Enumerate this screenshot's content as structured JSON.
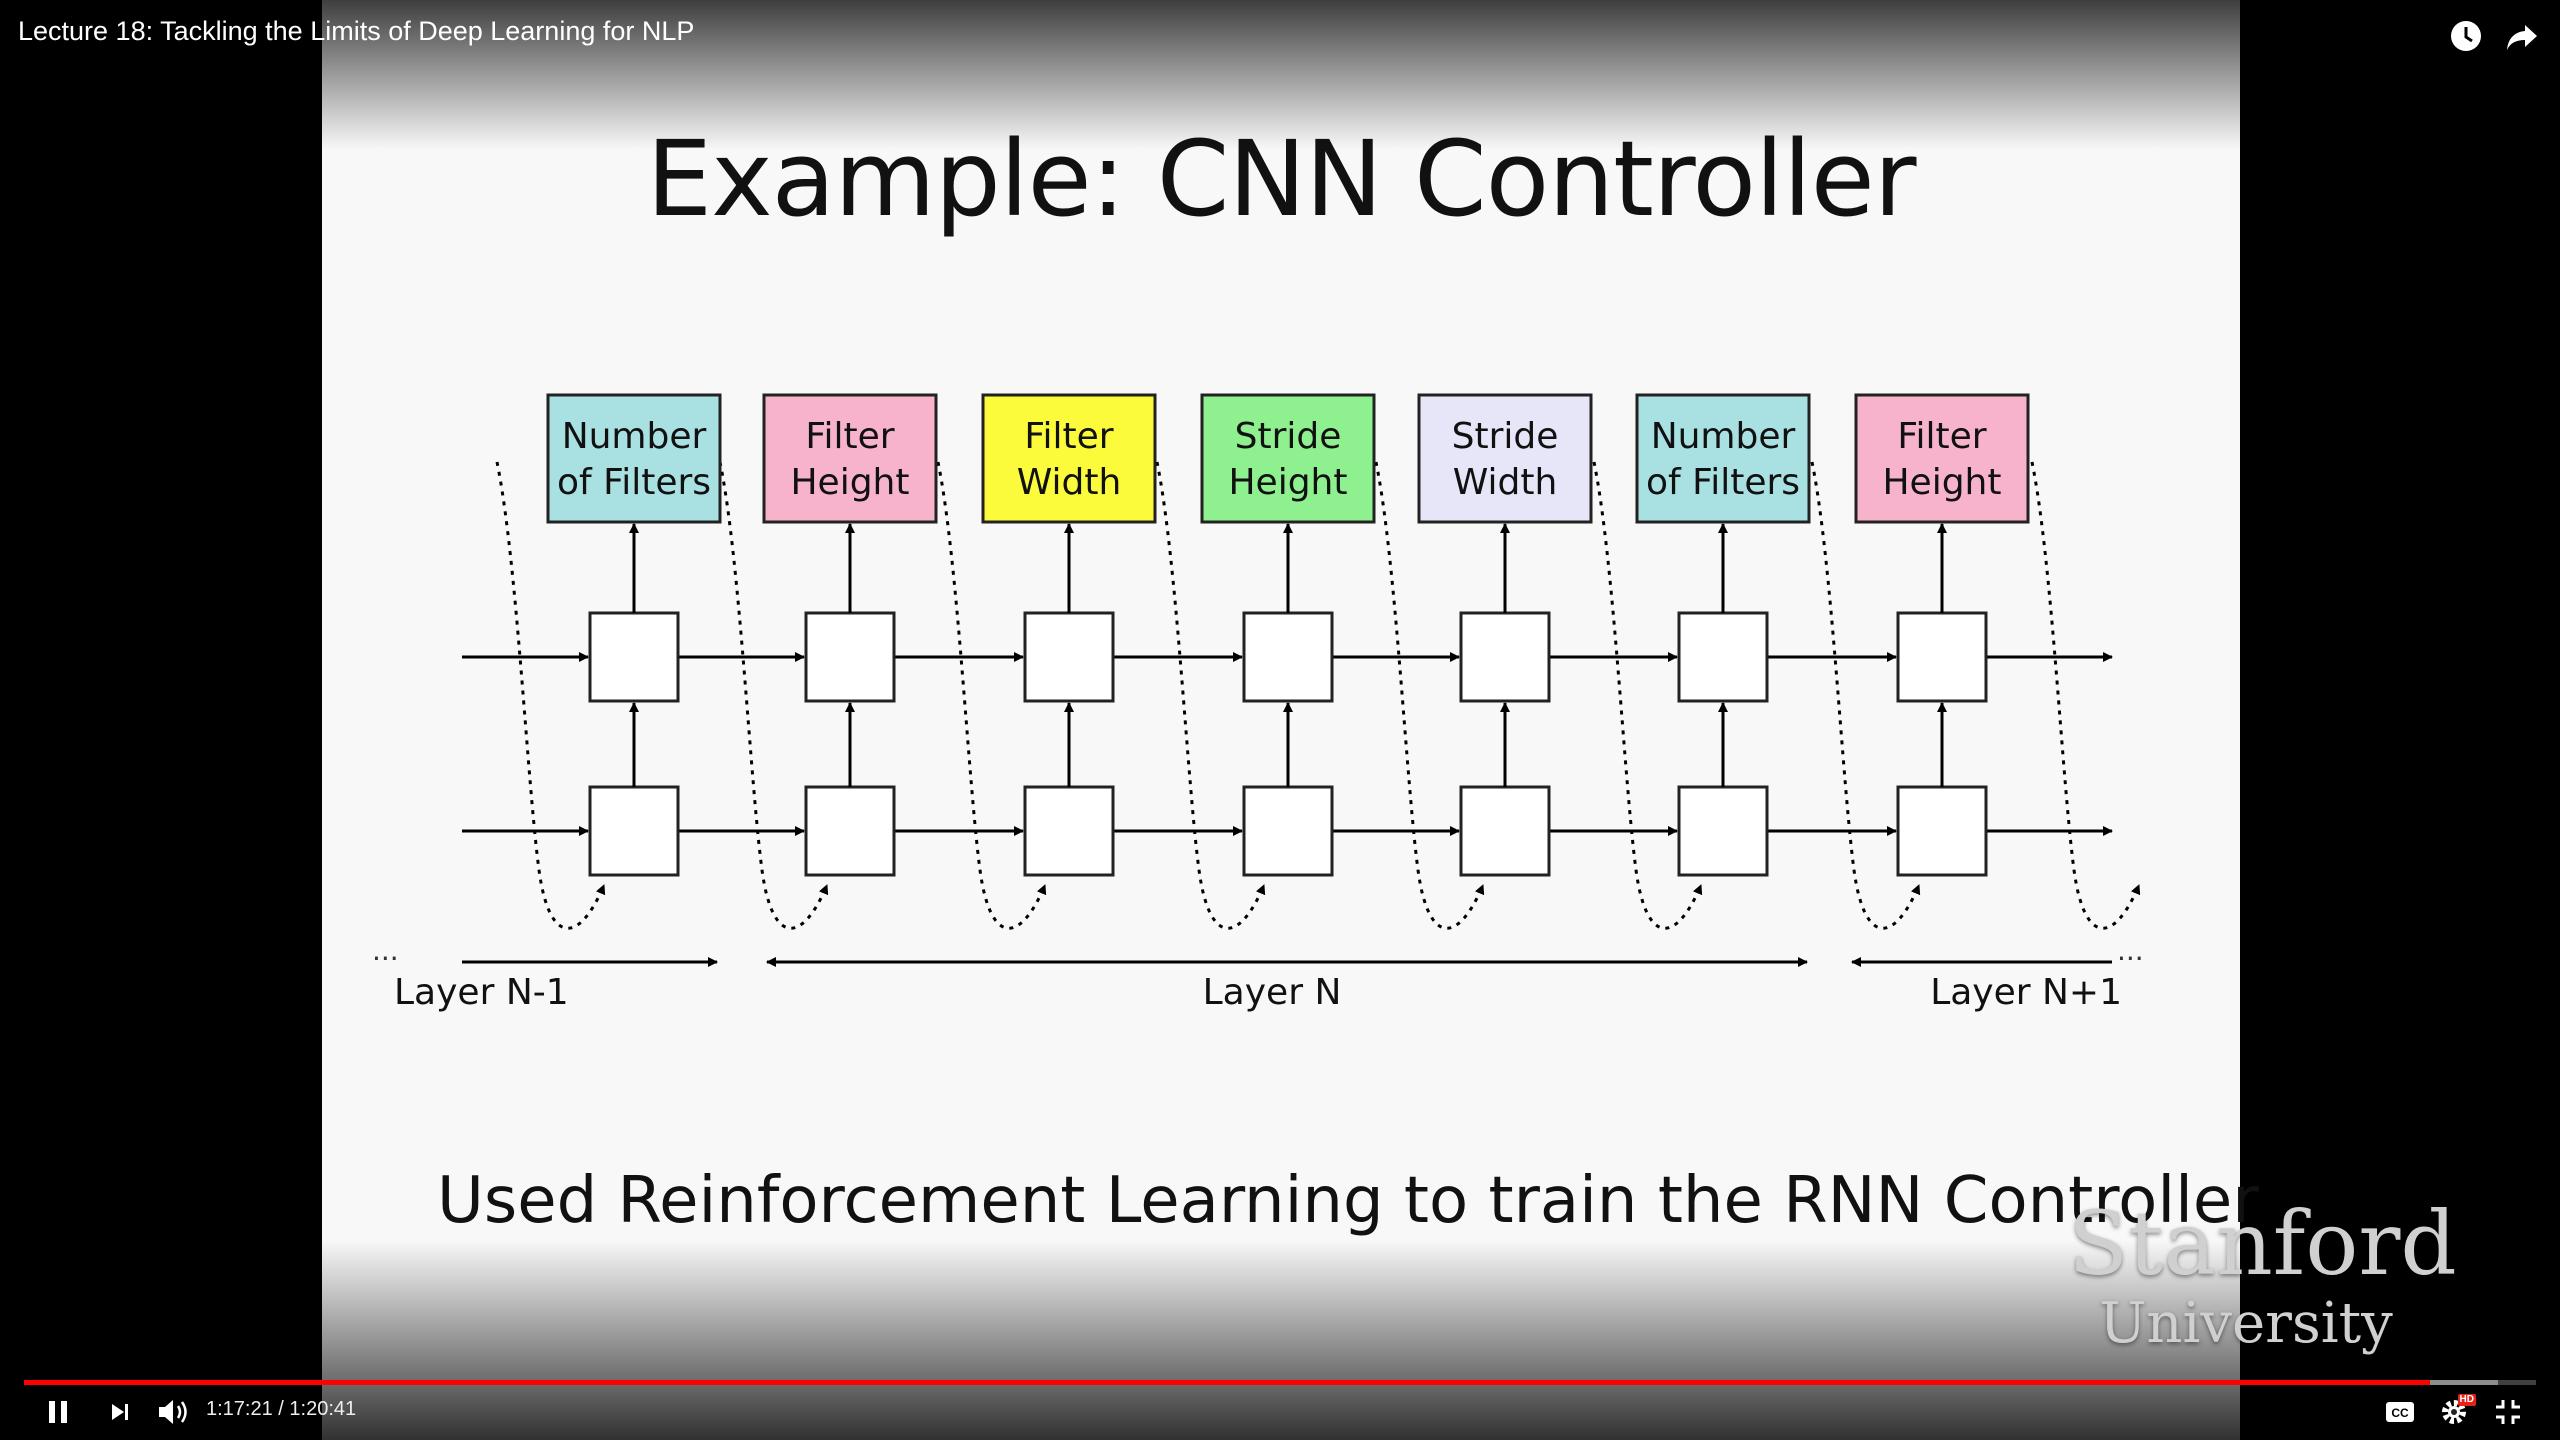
{
  "player": {
    "video_title": "Lecture 18: Tackling the Limits of Deep Learning for NLP",
    "time_display": "1:17:21 / 1:20:41",
    "progress_fraction": 0.958,
    "buffer_fraction": 0.985,
    "accent_color": "#ff0000",
    "icons": {
      "watch_later": "clock-icon",
      "share": "share-arrow-icon",
      "play_pause": "pause-icon",
      "next": "next-icon",
      "volume": "volume-icon",
      "captions": "cc-icon",
      "settings": "gear-icon",
      "fullscreen": "exit-fullscreen-icon"
    },
    "settings_badge": "HD"
  },
  "slide": {
    "title": "Example: CNN Controller",
    "caption": "Used Reinforcement Learning to train the RNN Controller",
    "watermark_line1": "Stanford",
    "watermark_line2": "University",
    "diagram": {
      "boxes": [
        {
          "line1": "Number",
          "line2": "of Filters",
          "color": "#a9e0e2"
        },
        {
          "line1": "Filter",
          "line2": "Height",
          "color": "#f6b3cb"
        },
        {
          "line1": "Filter",
          "line2": "Width",
          "color": "#fbfb3c"
        },
        {
          "line1": "Stride",
          "line2": "Height",
          "color": "#8ff08f"
        },
        {
          "line1": "Stride",
          "line2": "Width",
          "color": "#e6e6f8"
        },
        {
          "line1": "Number",
          "line2": "of Filters",
          "color": "#a9e0e2"
        },
        {
          "line1": "Filter",
          "line2": "Height",
          "color": "#f6b3cb"
        }
      ],
      "layer_labels": [
        "Layer N-1",
        "Layer N",
        "Layer N+1"
      ],
      "ellipsis": "..."
    }
  }
}
